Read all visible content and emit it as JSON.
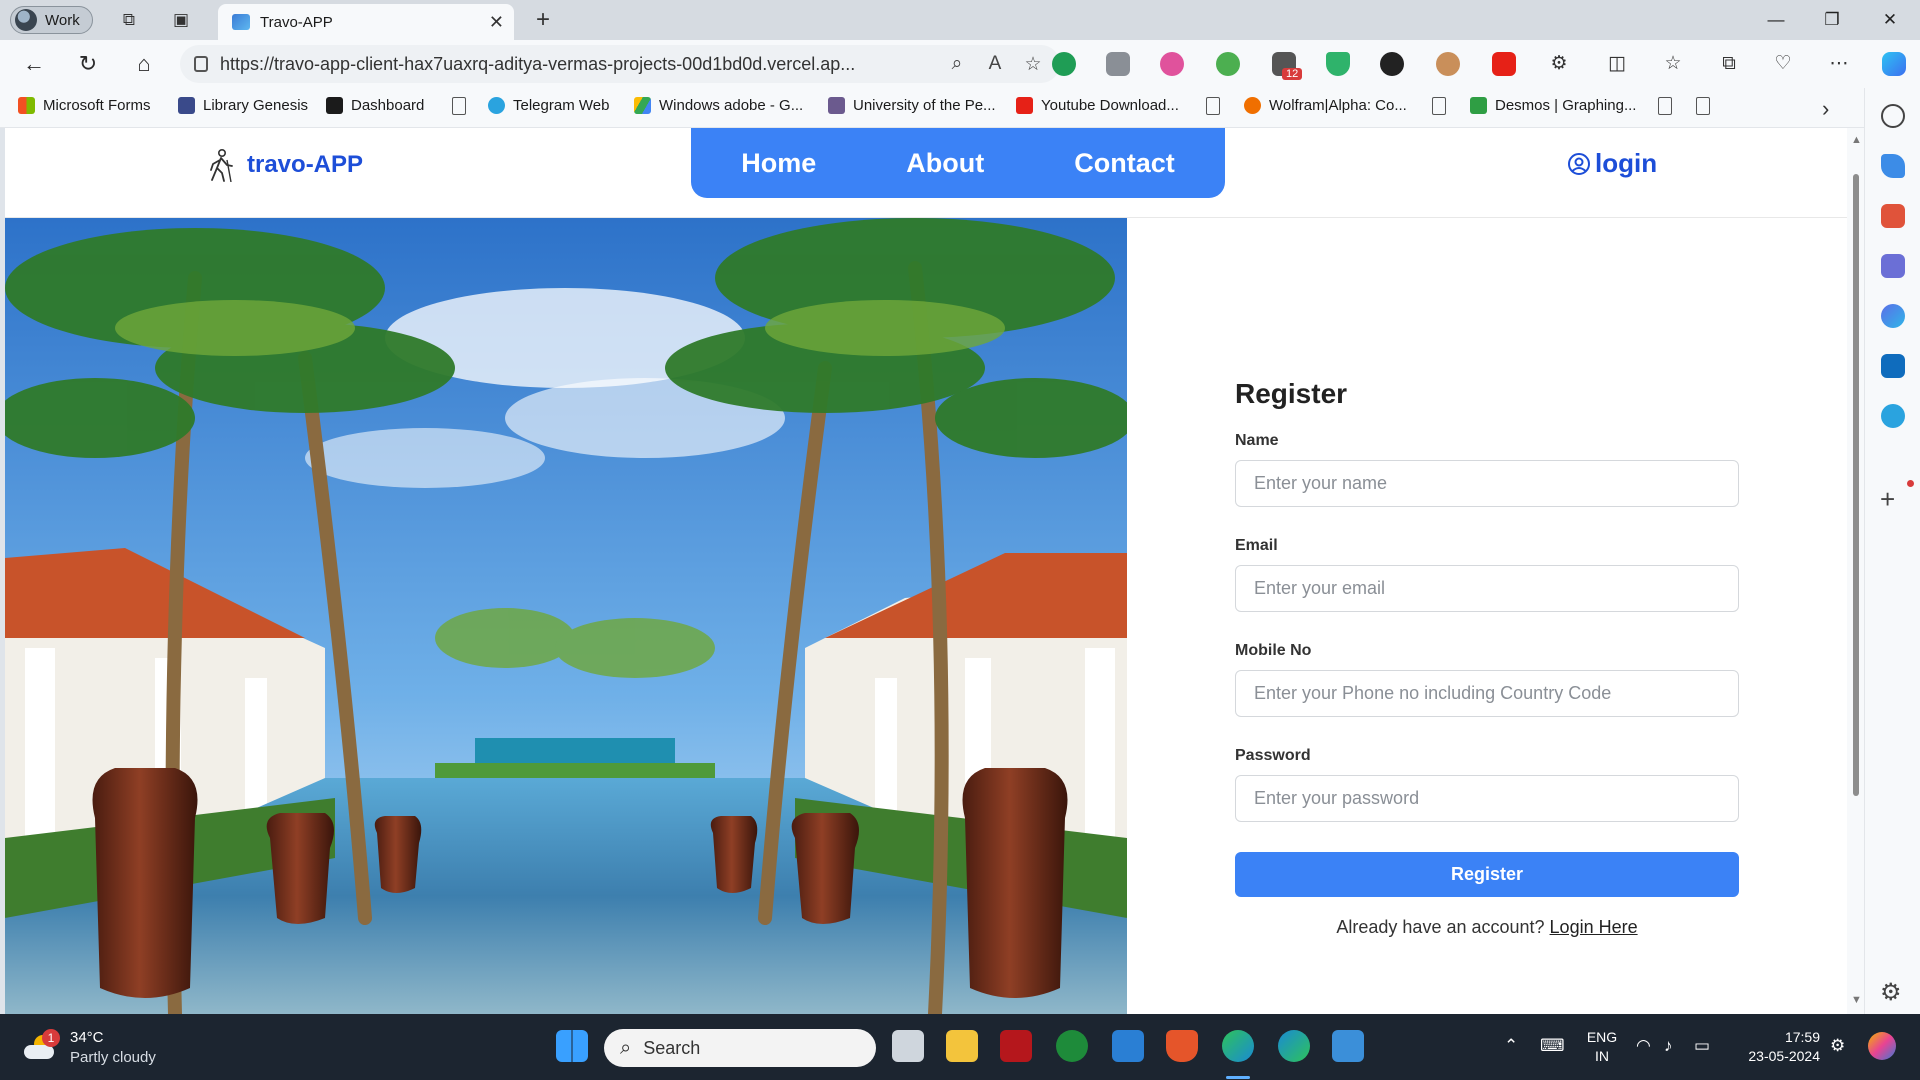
{
  "browser": {
    "profile_label": "Work",
    "tab_title": "Travo-APP",
    "url": "https://travo-app-client-hax7uaxrq-aditya-vermas-projects-00d1bd0d.vercel.ap...",
    "ext_badge": "12",
    "favorites": [
      {
        "label": "Microsoft Forms",
        "icon": "microsoft-logo",
        "color": "#f25022"
      },
      {
        "label": "Library Genesis",
        "icon": "library-icon",
        "color": "#3a4a8a"
      },
      {
        "label": "Dashboard",
        "icon": "dashboard-icon",
        "color": "#1b1b1b"
      },
      {
        "label": "",
        "icon": "document-icon",
        "color": "#555555"
      },
      {
        "label": "Telegram Web",
        "icon": "telegram-icon",
        "color": "#2aa3df"
      },
      {
        "label": "Windows adobe - G...",
        "icon": "google-drive-icon",
        "color": "#34a853"
      },
      {
        "label": "University of the Pe...",
        "icon": "university-icon",
        "color": "#6b5a8e"
      },
      {
        "label": "Youtube Download...",
        "icon": "youtube-download-icon",
        "color": "#e62117"
      },
      {
        "label": "",
        "icon": "document-icon",
        "color": "#555555"
      },
      {
        "label": "Wolfram|Alpha: Co...",
        "icon": "wolfram-icon",
        "color": "#f06f00"
      },
      {
        "label": "",
        "icon": "document-icon",
        "color": "#555555"
      },
      {
        "label": "Desmos | Graphing...",
        "icon": "desmos-icon",
        "color": "#2f9e44"
      },
      {
        "label": "",
        "icon": "document-icon",
        "color": "#555555"
      },
      {
        "label": "",
        "icon": "document-icon",
        "color": "#555555"
      }
    ]
  },
  "site": {
    "brand": "travo-APP",
    "nav": [
      {
        "label": "Home"
      },
      {
        "label": "About"
      },
      {
        "label": "Contact"
      }
    ],
    "login": "login",
    "accent": "#3b82f6",
    "brand_color": "#1d4ed8"
  },
  "register": {
    "title": "Register",
    "fields": [
      {
        "label": "Name",
        "placeholder": "Enter your name"
      },
      {
        "label": "Email",
        "placeholder": "Enter your email"
      },
      {
        "label": "Mobile No",
        "placeholder": "Enter your Phone no including Country Code"
      },
      {
        "label": "Password",
        "placeholder": "Enter your password"
      }
    ],
    "button": "Register",
    "footer_text": "Already have an account? ",
    "footer_link": "Login Here"
  },
  "taskbar": {
    "weather_badge": "1",
    "temperature": "34°C",
    "condition": "Partly cloudy",
    "search": "Search",
    "lang": "ENG",
    "region": "IN",
    "time": "17:59",
    "date": "23-05-2024"
  }
}
